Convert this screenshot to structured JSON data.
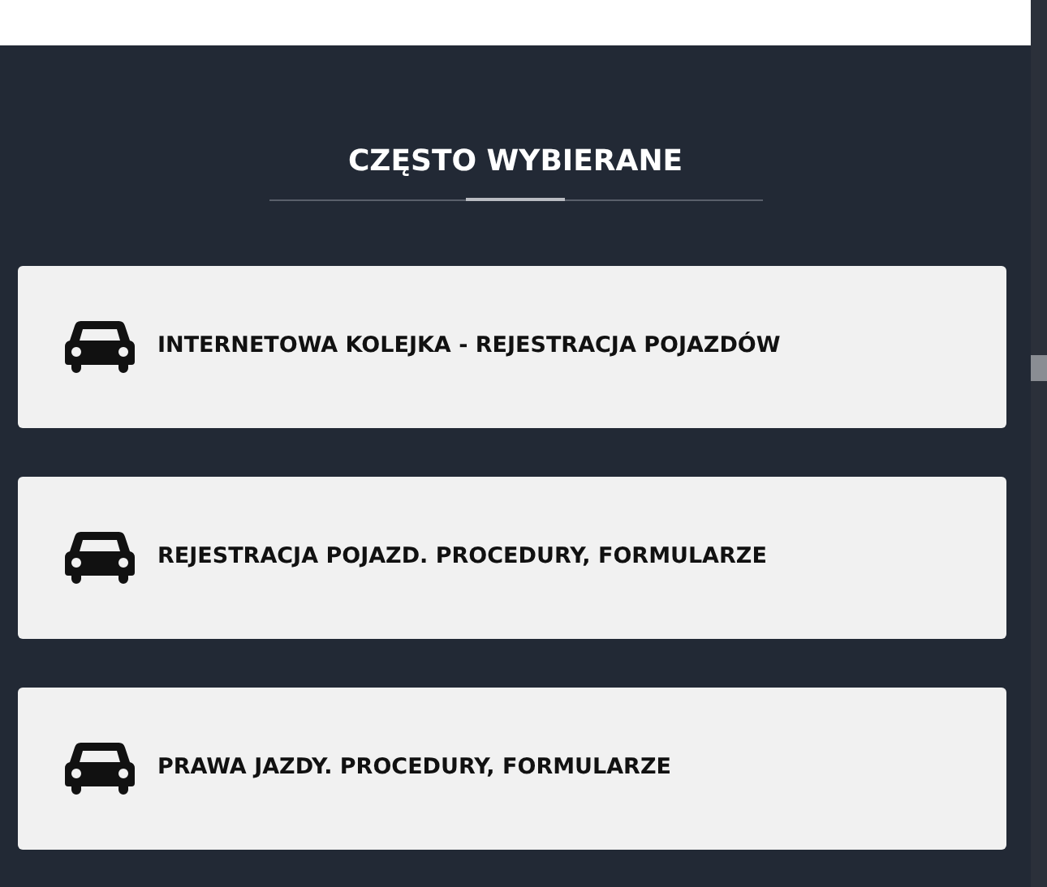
{
  "section": {
    "title": "CZĘSTO WYBIERANE"
  },
  "links": [
    {
      "label": "INTERNETOWA KOLEJKA - REJESTRACJA POJAZDÓW"
    },
    {
      "label": "REJESTRACJA POJAZD. PROCEDURY, FORMULARZE"
    },
    {
      "label": "PRAWA JAZDY. PROCEDURY, FORMULARZE"
    }
  ]
}
